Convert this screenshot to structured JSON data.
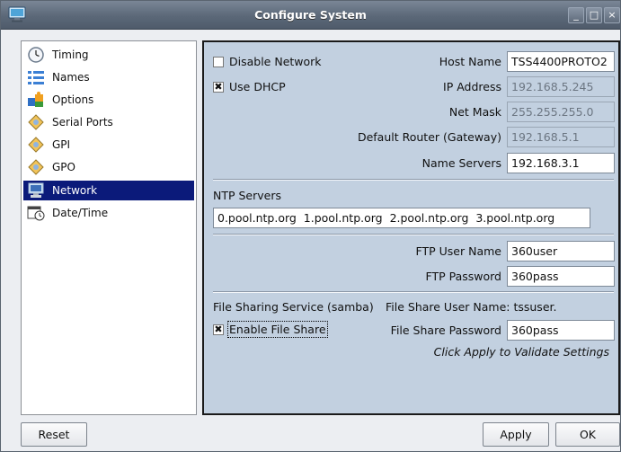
{
  "window": {
    "title": "Configure System",
    "controls": {
      "minimize": "_",
      "maximize": "□",
      "close": "×"
    }
  },
  "sidebar": {
    "items": [
      {
        "label": "Timing",
        "icon": "clock-icon"
      },
      {
        "label": "Names",
        "icon": "list-icon"
      },
      {
        "label": "Options",
        "icon": "puzzle-icon"
      },
      {
        "label": "Serial Ports",
        "icon": "port-icon"
      },
      {
        "label": "GPI",
        "icon": "port-icon"
      },
      {
        "label": "GPO",
        "icon": "port-icon"
      },
      {
        "label": "Network",
        "icon": "monitor-icon",
        "selected": true
      },
      {
        "label": "Date/Time",
        "icon": "calendar-clock-icon"
      }
    ]
  },
  "network": {
    "disable_network": {
      "label": "Disable Network",
      "checked": false
    },
    "use_dhcp": {
      "label": "Use DHCP",
      "checked": true
    },
    "host_name": {
      "label": "Host Name",
      "value": "TSS4400PROTO2"
    },
    "ip_address": {
      "label": "IP Address",
      "value": "192.168.5.245"
    },
    "net_mask": {
      "label": "Net Mask",
      "value": "255.255.255.0"
    },
    "default_router": {
      "label": "Default Router (Gateway)",
      "value": "192.168.5.1"
    },
    "name_servers": {
      "label": "Name Servers",
      "value": "192.168.3.1"
    },
    "ntp": {
      "label": "NTP Servers",
      "value": "0.pool.ntp.org  1.pool.ntp.org  2.pool.ntp.org  3.pool.ntp.org"
    },
    "ftp_user": {
      "label": "FTP User Name",
      "value": "360user"
    },
    "ftp_password": {
      "label": "FTP Password",
      "value": "360pass"
    },
    "samba": {
      "service_label": "File Sharing Service (samba)",
      "user_text": "File Share User Name: tssuser.",
      "enable": {
        "label": "Enable File Share",
        "checked": true
      },
      "password_label": "File Share Password",
      "password_value": "360pass"
    },
    "hint": "Click Apply to Validate Settings"
  },
  "buttons": {
    "reset": "Reset",
    "apply": "Apply",
    "ok": "OK"
  },
  "colors": {
    "selection": "#0b1a7a",
    "panel_bg": "#c2d0e0",
    "titlebar": "#5b6878"
  }
}
